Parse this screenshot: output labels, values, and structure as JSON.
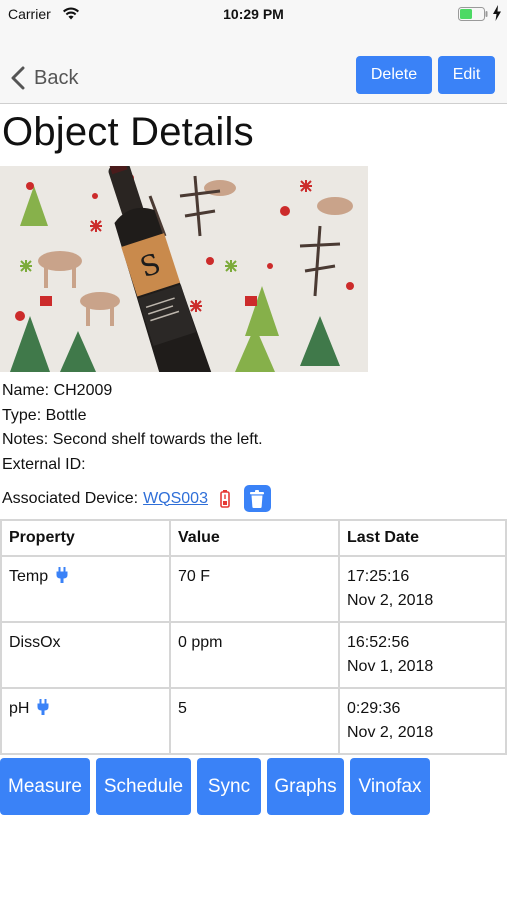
{
  "status_bar": {
    "carrier": "Carrier",
    "time": "10:29 PM"
  },
  "nav": {
    "back_label": "Back",
    "delete_label": "Delete",
    "edit_label": "Edit"
  },
  "page": {
    "title": "Object Details"
  },
  "object": {
    "name_line": "Name: CH2009",
    "type_line": "Type: Bottle",
    "notes_line": "Notes: Second shelf towards the left.",
    "external_id_line": "External ID:",
    "associated_device_label": "Associated Device:",
    "associated_device": "WQS003"
  },
  "table": {
    "headers": [
      "Property",
      "Value",
      "Last Date"
    ],
    "rows": [
      {
        "property": "Temp",
        "plug": true,
        "value": "70 F",
        "time": "17:25:16",
        "date": "Nov 2, 2018"
      },
      {
        "property": "DissOx",
        "plug": false,
        "value": "0 ppm",
        "time": "16:52:56",
        "date": "Nov 1, 2018"
      },
      {
        "property": "pH",
        "plug": true,
        "value": "5",
        "time": "0:29:36",
        "date": "Nov 2, 2018"
      }
    ]
  },
  "actions": [
    "Measure",
    "Schedule",
    "Sync",
    "Graphs",
    "Vinofax"
  ],
  "colors": {
    "accent": "#3a82f7",
    "battery_low": "#e53935",
    "battery_ok": "#4cd964",
    "link": "#2f6fd8"
  },
  "icons": {
    "wifi": "wifi-icon",
    "battery": "battery-icon",
    "charging": "bolt-icon",
    "back": "chevron-left-icon",
    "device_battery": "battery-low-icon",
    "trash": "trash-icon",
    "plug": "plug-icon"
  }
}
